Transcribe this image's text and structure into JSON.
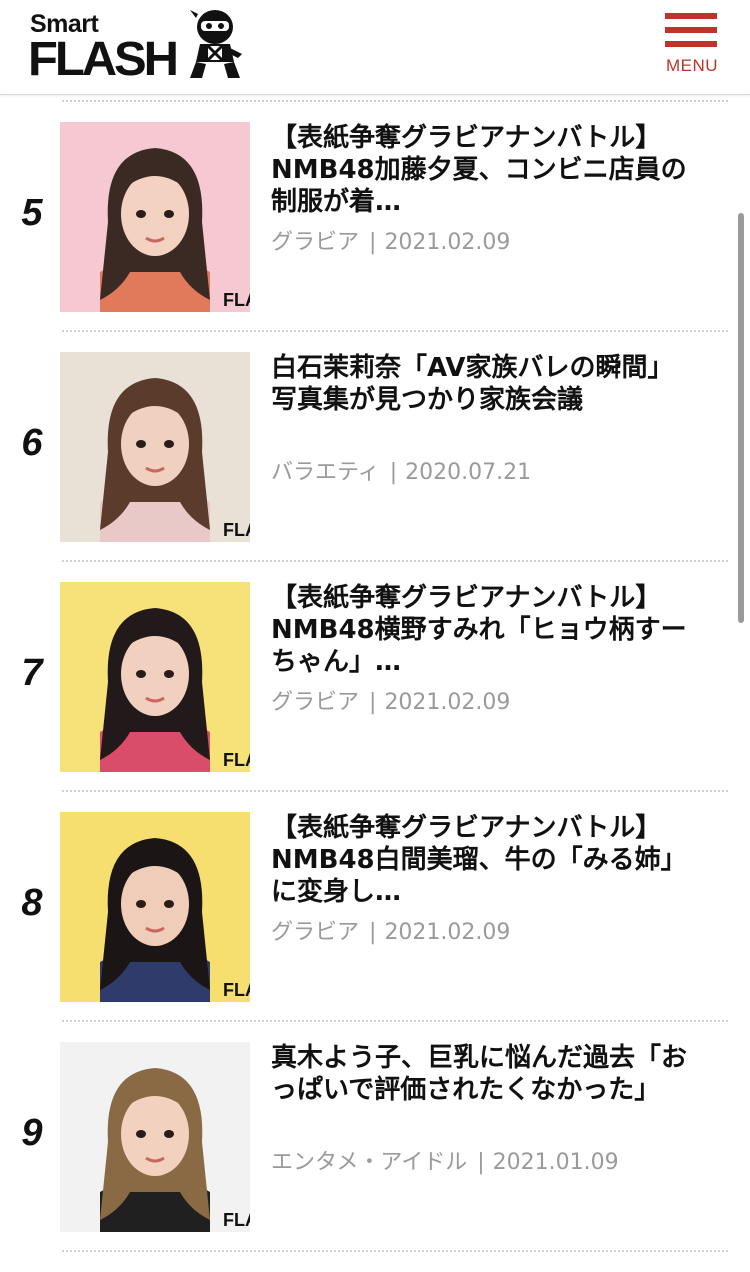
{
  "header": {
    "logo_top": "Smart",
    "logo_main": "FLASH",
    "menu_label": "MENU",
    "accent_color": "#c0332b"
  },
  "articles": [
    {
      "rank": "5",
      "title": "【表紙争奪グラビアナンバトル】\nNMB48加藤夕夏、コンビニ店員の\n制服が着…",
      "category": "グラビア",
      "date": "2021.02.09",
      "thumb_bg": "#f6c9d2",
      "thumb_label": "FLA"
    },
    {
      "rank": "6",
      "title": "白石茉莉奈「AV家族バレの瞬間」\n写真集が見つかり家族会議",
      "category": "バラエティ",
      "date": "2020.07.21",
      "thumb_bg": "#e9e0d6",
      "thumb_label": "FLA"
    },
    {
      "rank": "7",
      "title": "【表紙争奪グラビアナンバトル】\nNMB48横野すみれ「ヒョウ柄すー\nちゃん」…",
      "category": "グラビア",
      "date": "2021.02.09",
      "thumb_bg": "#f7e27a",
      "thumb_label": "FLA"
    },
    {
      "rank": "8",
      "title": "【表紙争奪グラビアナンバトル】\nNMB48白間美瑠、牛の「みる姉」\nに変身し…",
      "category": "グラビア",
      "date": "2021.02.09",
      "thumb_bg": "#f6df6e",
      "thumb_label": "FLA"
    },
    {
      "rank": "9",
      "title": "真木よう子、巨乳に悩んだ過去「お\nっぱいで評価されたくなかった」",
      "category": "エンタメ・アイドル",
      "date": "2021.01.09",
      "thumb_bg": "#f2f2f2",
      "thumb_label": "FLA"
    }
  ]
}
